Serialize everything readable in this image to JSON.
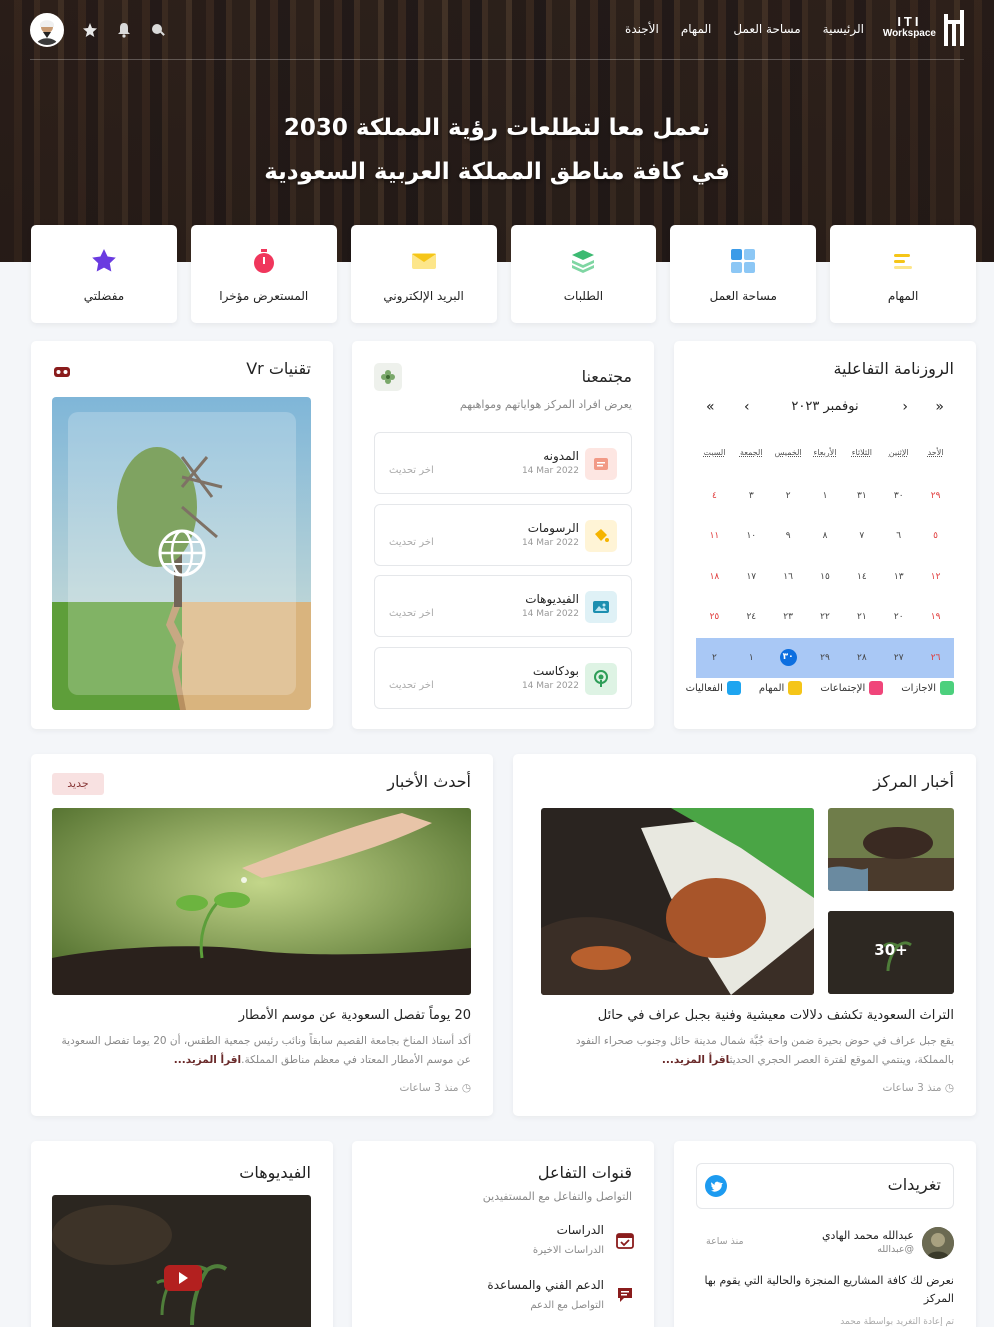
{
  "header": {
    "logo_line1": "ITI",
    "logo_line2": "Workspace",
    "nav": [
      "الرئيسية",
      "مساحة العمل",
      "المهام",
      "الأجندة"
    ],
    "hero_line1": "نعمل معا لتطلعات رؤية المملكة 2030",
    "hero_line2": "في كافة مناطق المملكة العربية السعودية"
  },
  "quick_links": [
    {
      "label": "المهام",
      "icon": "tasks-icon",
      "color": "#f5c518"
    },
    {
      "label": "مساحة العمل",
      "icon": "workspace-grid-icon",
      "color": "#3b9be8"
    },
    {
      "label": "الطلبات",
      "icon": "layers-icon",
      "color": "#3cba72"
    },
    {
      "label": "البريد الإلكتروني",
      "icon": "mail-icon",
      "color": "#f5c518"
    },
    {
      "label": "المستعرض مؤخرا",
      "icon": "stopwatch-icon",
      "color": "#f0365c"
    },
    {
      "label": "مفضلتي",
      "icon": "star-icon",
      "color": "#6a3be0"
    }
  ],
  "calendar": {
    "title": "الروزنامة التفاعلية",
    "month": "نوفمبر ٢٠٢٣",
    "nav": {
      "prev_year": "«",
      "prev": "‹",
      "next": "›",
      "next_year": "»"
    },
    "weekdays": [
      "الأحد",
      "الإثنين",
      "الثلاثاء",
      "الأربعاء",
      "الخميس",
      "الجمعة",
      "السبت"
    ],
    "weeks": [
      [
        "٢٩",
        "٣٠",
        "٣١",
        "١",
        "٢",
        "٣",
        "٤"
      ],
      [
        "٥",
        "٦",
        "٧",
        "٨",
        "٩",
        "١٠",
        "١١"
      ],
      [
        "١٢",
        "١٣",
        "١٤",
        "١٥",
        "١٦",
        "١٧",
        "١٨"
      ],
      [
        "١٩",
        "٢٠",
        "٢١",
        "٢٢",
        "٢٣",
        "٢٤",
        "٢٥"
      ],
      [
        "٢٦",
        "٢٧",
        "٢٨",
        "٢٩",
        "٣٠",
        "١",
        "٢"
      ]
    ],
    "legend": [
      {
        "label": "الاجازات",
        "color": "#4cd07d"
      },
      {
        "label": "الإجتماعات",
        "color": "#f0457a"
      },
      {
        "label": "المهام",
        "color": "#f5c518"
      },
      {
        "label": "الفعاليات",
        "color": "#1ea5f0"
      }
    ],
    "selected_color": "#a9c8f5"
  },
  "community": {
    "title": "مجتمعنا",
    "subtitle": "يعرض افراد المركز هواياتهم ومواهبهم",
    "items": [
      {
        "name": "المدونه",
        "date": "14 Mar 2022",
        "update": "اخر تحديث",
        "icon": "blog-icon",
        "bg": "#fde6e2",
        "fg": "#f29a86"
      },
      {
        "name": "الرسومات",
        "date": "14 Mar 2022",
        "update": "اخر تحديث",
        "icon": "paint-bucket-icon",
        "bg": "#fff4d6",
        "fg": "#f5b400"
      },
      {
        "name": "الفيديوهات",
        "date": "14 Mar 2022",
        "update": "اخر تحديث",
        "icon": "gallery-icon",
        "bg": "#dff1f6",
        "fg": "#1c8fb0"
      },
      {
        "name": "بودكاست",
        "date": "14 Mar 2022",
        "update": "اخر تحديث",
        "icon": "podcast-icon",
        "bg": "#def3e4",
        "fg": "#2e9e58"
      }
    ]
  },
  "vr": {
    "title": "تقنيات Vr"
  },
  "center_news": {
    "title": "أخبار المركز",
    "more_count": "+30",
    "headline": "التراث السعودية تكشف دلالات معيشية وفنية بجبل عراف في حائل",
    "body": "يقع جبل عراف في حوض بحيرة ضمن واحة جُبَّة شمال مدينة حائل وجنوب صحراء النفود بالمملكة، وينتمي الموقع لفترة العصر الحجري الحديث",
    "more": "اقرأ المزيد...",
    "time": "منذ 3 ساعات"
  },
  "latest_news": {
    "title": "أحدث الأخبار",
    "badge": "جديد",
    "headline": "20 يوماً تفصل السعودية عن موسم الأمطار",
    "body": "أكد أستاذ المناخ بجامعة القصيم سابقاً ونائب رئيس جمعية الطقس، أن 20 يوما تفصل السعودية عن موسم الأمطار المعتاد في معظم مناطق المملكة.",
    "more": "اقرأ المزيد...",
    "time": "منذ 3 ساعات"
  },
  "videos": {
    "title": "الفيديوهات"
  },
  "channels": {
    "title": "قنوات التفاعل",
    "subtitle": "التواصل والتفاعل مع المستفيدين",
    "items": [
      {
        "name": "الدراسات",
        "sub": "الدراسات الاخيرة",
        "icon": "calendar-check-icon"
      },
      {
        "name": "الدعم الفني والمساعدة",
        "sub": "التواصل مع الدعم",
        "icon": "chat-icon"
      }
    ]
  },
  "tweets": {
    "title": "تغريدات",
    "author": "عبدالله محمد الهادي",
    "handle": "@عبدالله",
    "time": "منذ ساعة",
    "text": "نعرض لك كافة المشاريع المنجزة والحالية التي يقوم بها المركز",
    "footer": "تم إعادة التغريد بواسطة محمد"
  }
}
